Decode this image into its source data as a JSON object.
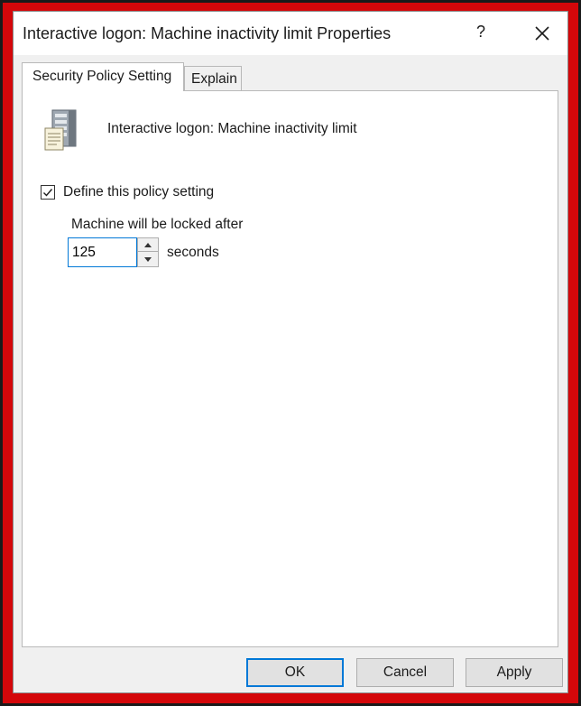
{
  "window": {
    "title": "Interactive logon: Machine inactivity limit Properties",
    "help_glyph": "?",
    "close_icon": "close-icon"
  },
  "tabs": [
    {
      "label": "Security Policy Setting",
      "active": true
    },
    {
      "label": "Explain",
      "active": false
    }
  ],
  "policy": {
    "icon": "server-policy-icon",
    "name": "Interactive logon: Machine inactivity limit",
    "define_checkbox_label": "Define this policy setting",
    "define_checked": true,
    "lock_label": "Machine will be locked after",
    "lock_value": "125",
    "unit_label": "seconds"
  },
  "buttons": {
    "ok": "OK",
    "cancel": "Cancel",
    "apply": "Apply"
  },
  "colors": {
    "frame_border": "#d4070a",
    "focus_accent": "#0078d7"
  }
}
